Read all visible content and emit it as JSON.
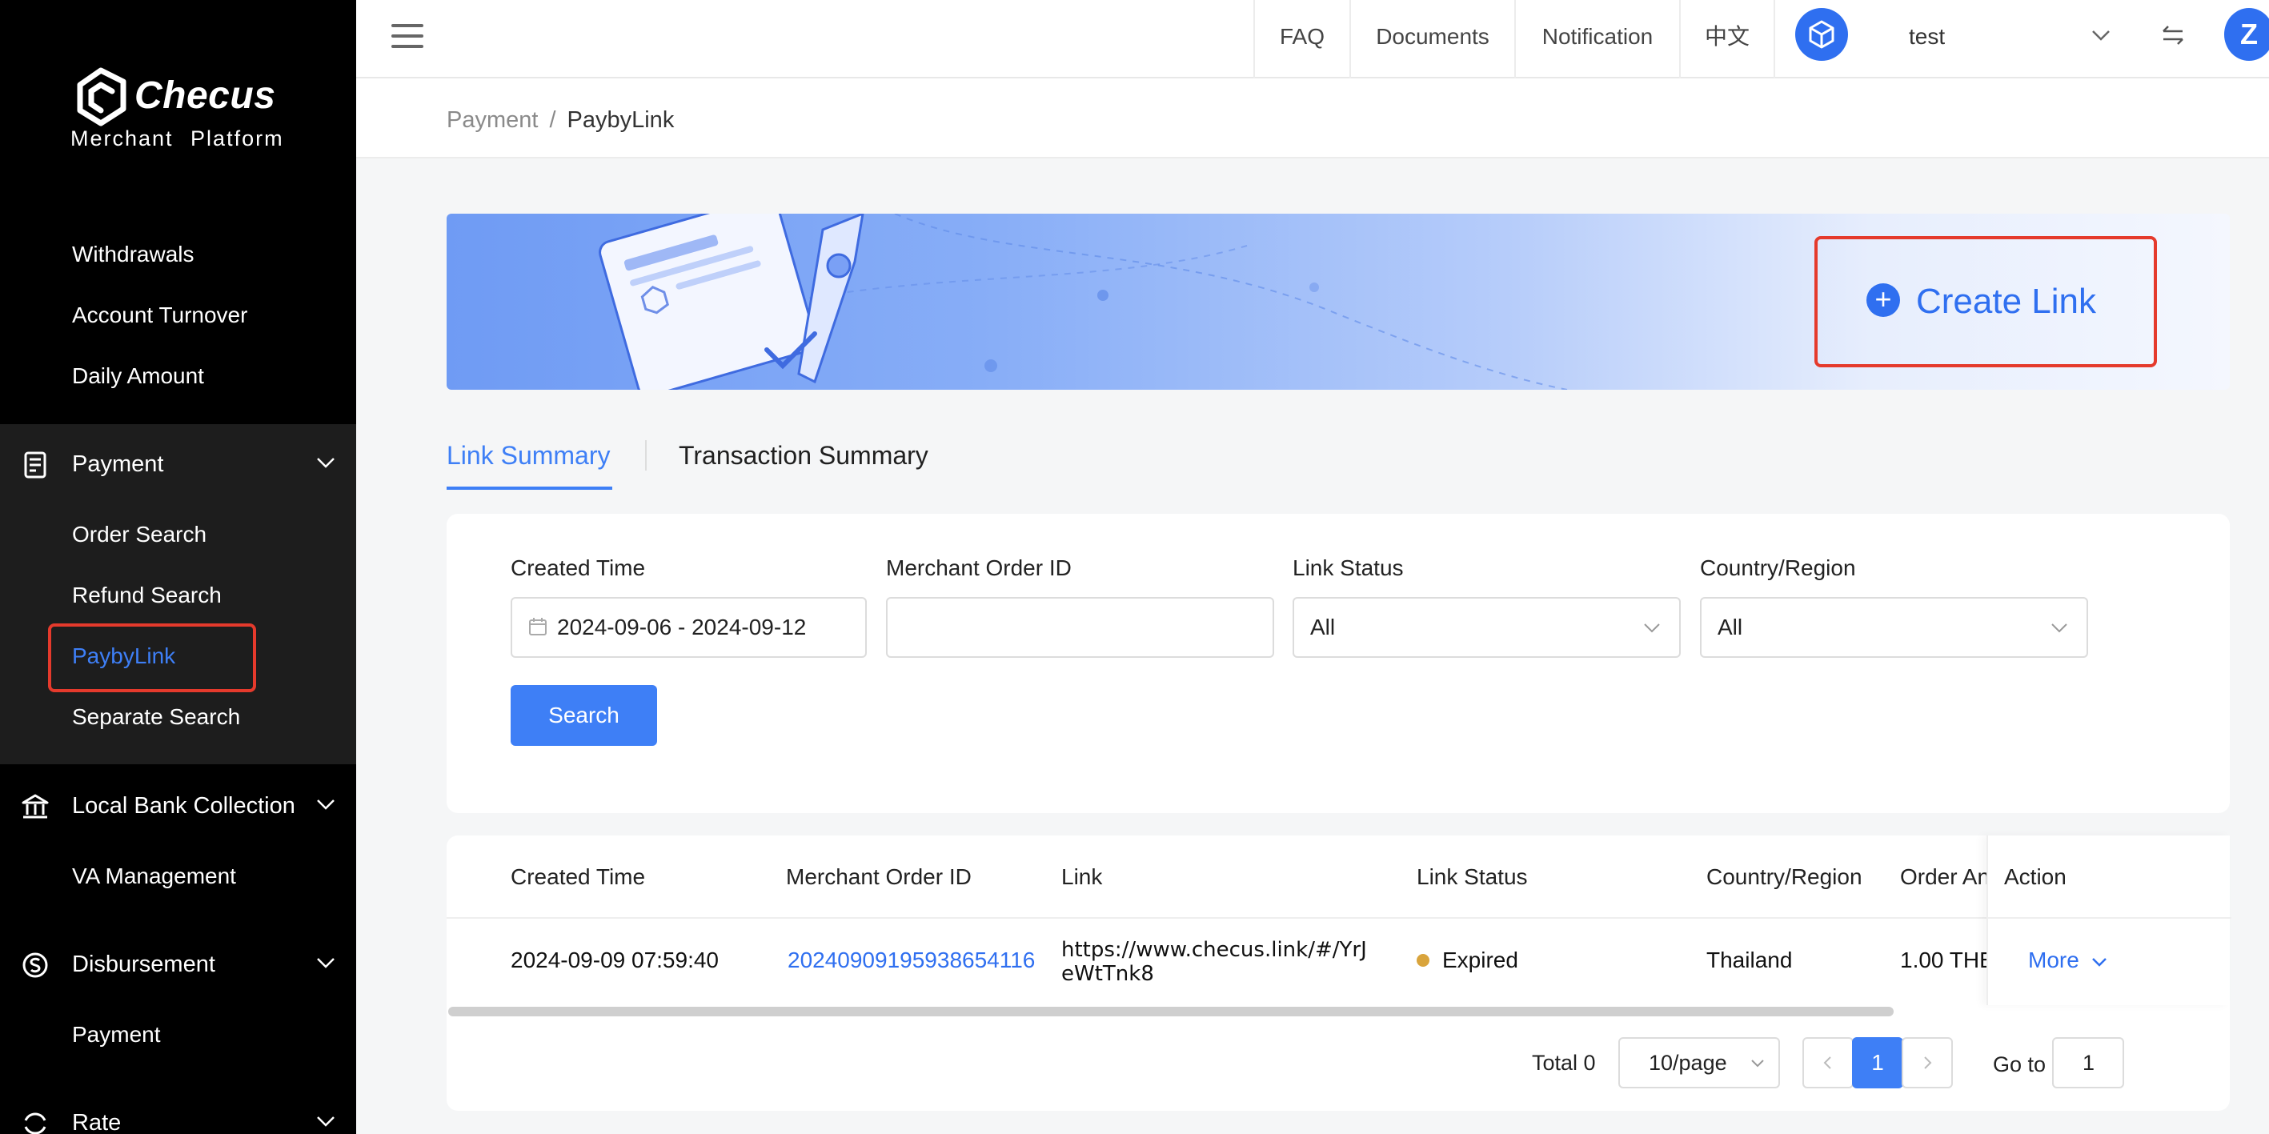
{
  "brand": {
    "name": "Checus",
    "subtitle": "Merchant  Platform"
  },
  "sidebar": {
    "top_items": [
      {
        "label": "Withdrawals"
      },
      {
        "label": "Account Turnover"
      },
      {
        "label": "Daily Amount"
      }
    ],
    "payment": {
      "label": "Payment",
      "items": [
        {
          "label": "Order Search"
        },
        {
          "label": "Refund Search"
        },
        {
          "label": "PaybyLink"
        },
        {
          "label": "Separate Search"
        }
      ]
    },
    "local_bank": {
      "label": "Local Bank Collection",
      "items": [
        {
          "label": "VA Management"
        }
      ]
    },
    "disbursement": {
      "label": "Disbursement",
      "items": [
        {
          "label": "Payment"
        }
      ]
    },
    "rate": {
      "label": "Rate"
    }
  },
  "topbar": {
    "nav": [
      "FAQ",
      "Documents",
      "Notification",
      "中文"
    ],
    "username": "test",
    "avatar_letter": "Z"
  },
  "breadcrumb": {
    "parent": "Payment",
    "separator": "/",
    "current": "PaybyLink"
  },
  "banner": {
    "create_label": "Create Link"
  },
  "tabs": [
    {
      "label": "Link Summary"
    },
    {
      "label": "Transaction Summary"
    }
  ],
  "filters": {
    "created_time": {
      "label": "Created Time",
      "value": "2024-09-06 - 2024-09-12"
    },
    "merchant_order_id": {
      "label": "Merchant Order ID",
      "value": ""
    },
    "link_status": {
      "label": "Link Status",
      "value": "All"
    },
    "country_region": {
      "label": "Country/Region",
      "value": "All"
    },
    "search_label": "Search"
  },
  "table": {
    "columns": [
      "Created Time",
      "Merchant Order ID",
      "Link",
      "Link Status",
      "Country/Region",
      "Order An",
      "Action"
    ],
    "rows": [
      {
        "created_time": "2024-09-09 07:59:40",
        "merchant_order_id": "20240909195938654116",
        "link_line1": "https://www.checus.link/#/YrJ",
        "link_line2": "eWtTnk8",
        "status": "Expired",
        "country": "Thailand",
        "amount": "1.00 THE",
        "action": "More"
      }
    ]
  },
  "pagination": {
    "total": "Total 0",
    "page_size": "10/page",
    "current_page": "1",
    "goto_label": "Go to",
    "goto_value": "1"
  },
  "colors": {
    "accent": "#3e7ff6",
    "highlight": "#e53a2c",
    "sidebar": "#000000",
    "status_expired": "#d9a43c"
  }
}
